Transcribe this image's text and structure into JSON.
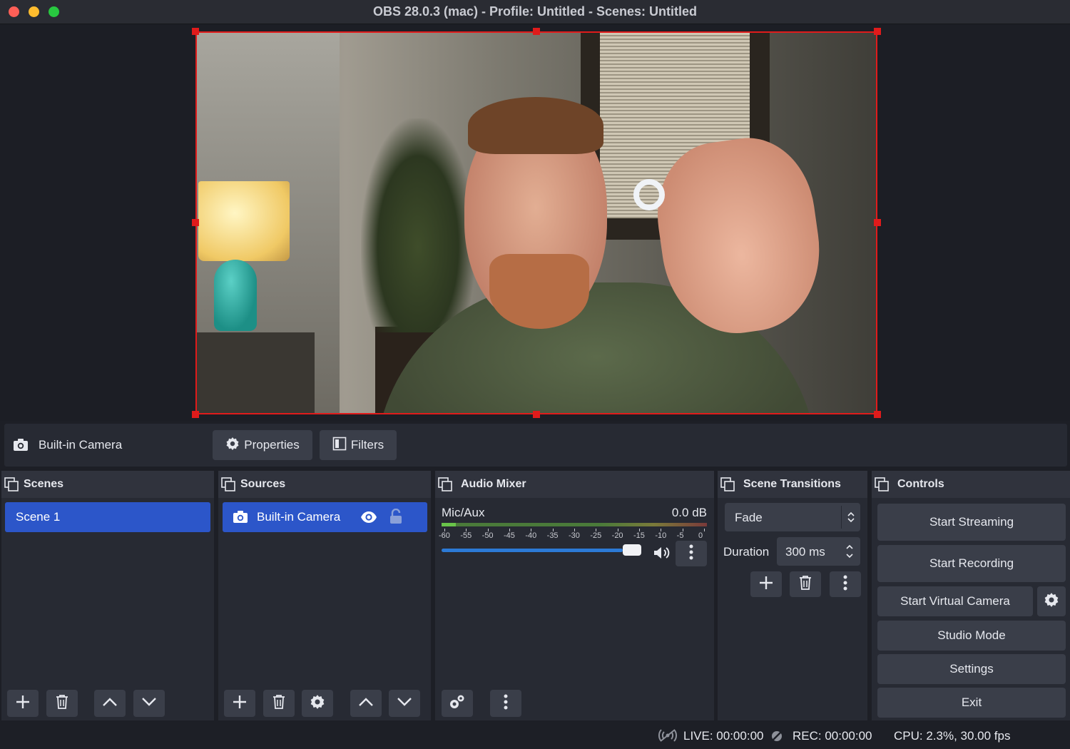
{
  "window": {
    "title": "OBS 28.0.3 (mac) - Profile: Untitled - Scenes: Untitled"
  },
  "source_toolbar": {
    "source_name": "Built-in Camera",
    "properties_label": "Properties",
    "filters_label": "Filters"
  },
  "scenes": {
    "title": "Scenes",
    "items": [
      {
        "label": "Scene 1",
        "selected": true
      }
    ]
  },
  "sources": {
    "title": "Sources",
    "items": [
      {
        "label": "Built-in Camera",
        "visible": true,
        "locked": false
      }
    ]
  },
  "audio_mixer": {
    "title": "Audio Mixer",
    "channel": {
      "name": "Mic/Aux",
      "level": "0.0 dB",
      "volume_fraction": 1.0,
      "scale": [
        "-60",
        "-55",
        "-50",
        "-45",
        "-40",
        "-35",
        "-30",
        "-25",
        "-20",
        "-15",
        "-10",
        "-5",
        "0"
      ]
    }
  },
  "scene_transitions": {
    "title": "Scene Transitions",
    "transition": "Fade",
    "duration_label": "Duration",
    "duration_value": "300 ms"
  },
  "controls": {
    "title": "Controls",
    "start_streaming": "Start Streaming",
    "start_recording": "Start Recording",
    "start_virtual_camera": "Start Virtual Camera",
    "studio_mode": "Studio Mode",
    "settings": "Settings",
    "exit": "Exit"
  },
  "status": {
    "live": "LIVE: 00:00:00",
    "rec": "REC: 00:00:00",
    "cpu": "CPU: 2.3%, 30.00 fps"
  },
  "colors": {
    "accent": "#2c56c9",
    "selection_red": "#e01b1b",
    "panel": "#272a33",
    "background": "#1d1f26"
  }
}
